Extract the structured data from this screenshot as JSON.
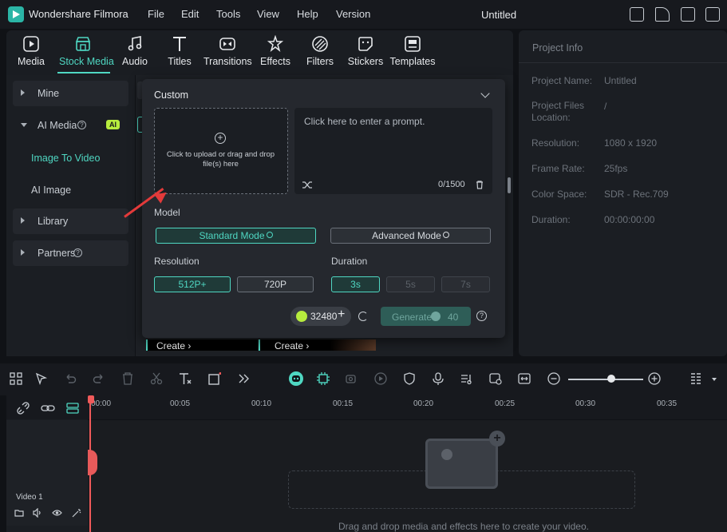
{
  "titlebar": {
    "app_name": "Wondershare Filmora",
    "menus": [
      "File",
      "Edit",
      "Tools",
      "View",
      "Help",
      "Version"
    ],
    "document_title": "Untitled"
  },
  "toolbar": {
    "tabs": [
      {
        "label": "Media",
        "icon": "media-icon"
      },
      {
        "label": "Stock Media",
        "icon": "stock-media-icon",
        "active": true
      },
      {
        "label": "Audio",
        "icon": "music-note-icon"
      },
      {
        "label": "Titles",
        "icon": "text-icon"
      },
      {
        "label": "Transitions",
        "icon": "transitions-icon"
      },
      {
        "label": "Effects",
        "icon": "effects-icon"
      },
      {
        "label": "Filters",
        "icon": "filters-icon"
      },
      {
        "label": "Stickers",
        "icon": "stickers-icon"
      },
      {
        "label": "Templates",
        "icon": "templates-icon"
      }
    ],
    "accent_color": "#4fd7c2"
  },
  "sidebar": {
    "mine": "Mine",
    "ai_media": "AI Media",
    "ai_badge": "AI",
    "image_to_video": "Image To Video",
    "ai_image": "AI Image",
    "library": "Library",
    "partners": "Partners"
  },
  "popup": {
    "title": "Custom",
    "upload_text": "Click to upload or drag and drop file(s) here",
    "prompt_placeholder": "Click here to enter a prompt.",
    "prompt_count": "0/1500",
    "model_label": "Model",
    "model_options": [
      "Standard Mode",
      "Advanced Mode"
    ],
    "model_selected": "Standard Mode",
    "resolution_label": "Resolution",
    "resolution_options": [
      "512P+",
      "720P"
    ],
    "resolution_selected": "512P+",
    "duration_label": "Duration",
    "duration_options": [
      "3s",
      "5s",
      "7s"
    ],
    "duration_selected": "3s",
    "credits": "32480",
    "generate_label": "Generate",
    "generate_cost": "40"
  },
  "middle": {
    "create_label": "Create"
  },
  "project_info": {
    "title": "Project Info",
    "fields": [
      {
        "key": "Project Name:",
        "value": "Untitled"
      },
      {
        "key": "Project Files Location:",
        "value": "/"
      },
      {
        "key": "Resolution:",
        "value": "1080 x 1920"
      },
      {
        "key": "Frame Rate:",
        "value": "25fps"
      },
      {
        "key": "Color Space:",
        "value": "SDR - Rec.709"
      },
      {
        "key": "Duration:",
        "value": "00:00:00:00"
      }
    ]
  },
  "timeline": {
    "ticks": [
      "00:00",
      "00:05",
      "00:10",
      "00:15",
      "00:20",
      "00:25",
      "00:30",
      "00:35"
    ],
    "track_label": "Video 1",
    "drop_text": "Drag and drop media and effects here to create your video."
  }
}
